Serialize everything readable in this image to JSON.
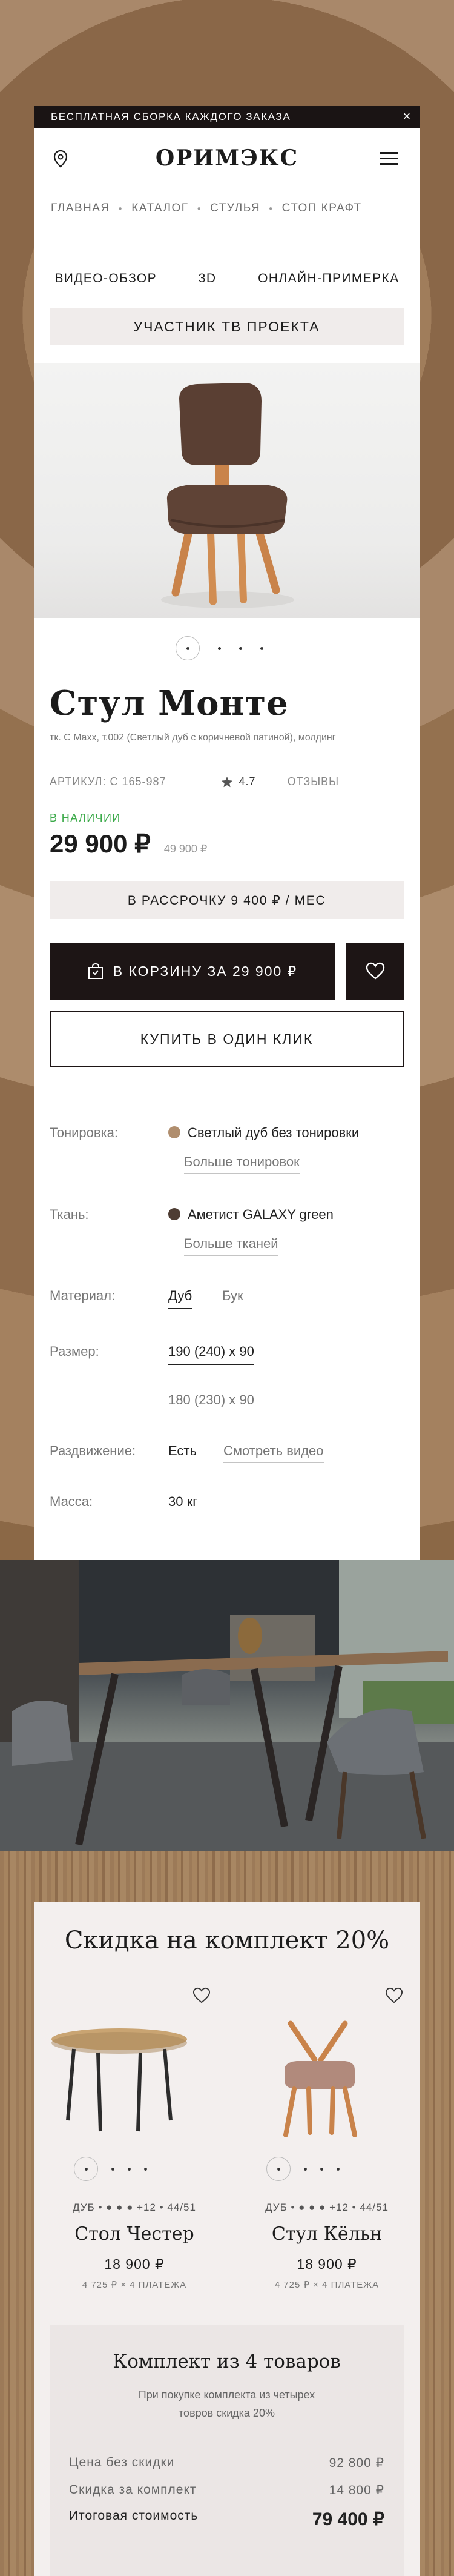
{
  "promo_bar": {
    "text": "БЕСПЛАТНАЯ СБОРКА КАЖДОГО ЗАКАЗА",
    "close": "×"
  },
  "header": {
    "logo": "ОРИМЭКС"
  },
  "breadcrumb": [
    "ГЛАВНАЯ",
    "КАТАЛОГ",
    "СТУЛЬЯ",
    "СТОП КРАФТ"
  ],
  "media_tabs": [
    "ВИДЕО-ОБЗОР",
    "3D",
    "ОНЛАЙН-ПРИМЕРКА"
  ],
  "tv_button": "УЧАСТНИК ТВ ПРОЕКТА",
  "product": {
    "title": "Стул Монте",
    "subtitle": "тк. С Maxx, т.002 (Светлый дуб с коричневой патиной), молдинг",
    "article": "АРТИКУЛ: С 165-987",
    "rating": "4.7",
    "reviews": "ОТЗЫВЫ",
    "stock": "В НАЛИЧИИ",
    "price": "29 900 ₽",
    "old_price": "49 900 ₽",
    "installment": "В РАССРОЧКУ 9 400 ₽ / МЕС",
    "cart_button": "В КОРЗИНУ ЗА 29 900 ₽",
    "one_click": "КУПИТЬ В ОДИН КЛИК"
  },
  "specs": {
    "toning_label": "Тонировка:",
    "toning_value": "Светлый дуб без тонировки",
    "toning_more": "Больше тонировок",
    "fabric_label": "Ткань:",
    "fabric_value": "Аметист GALAXY green",
    "fabric_more": "Больше тканей",
    "material_label": "Материал:",
    "material_options": [
      "Дуб",
      "Бук"
    ],
    "size_label": "Размер:",
    "size_options": [
      "190 (240) х 90",
      "180 (230) х 90"
    ],
    "extend_label": "Раздвижение:",
    "extend_value": "Есть",
    "extend_video": "Смотреть видео",
    "weight_label": "Масса:",
    "weight_value": "30 кг"
  },
  "colors": {
    "toning_swatch": "#b08e6e",
    "fabric_swatch": "#4e3d33",
    "stock": "#3caa4a",
    "dark": "#1d1515"
  },
  "set_offer": {
    "title": "Скидка на комплект 20%",
    "products": [
      {
        "colors": "ДУБ • ● ● ● +12 • 44/51",
        "name": "Стол Честер",
        "price": "18 900 ₽",
        "installment": "4 725 ₽ × 4 ПЛАТЕЖА"
      },
      {
        "colors": "ДУБ • ● ● ● +12 • 44/51",
        "name": "Стул Кёльн",
        "price": "18 900 ₽",
        "installment": "4 725 ₽ × 4 ПЛАТЕЖА"
      }
    ],
    "summary": {
      "title": "Комплект из 4 товаров",
      "description": "При покупке комплекта из четырех товров скидка 20%",
      "rows": [
        {
          "label": "Цена без скидки",
          "value": "92 800 ₽"
        },
        {
          "label": "Скидка за комплект",
          "value": "14 800 ₽"
        },
        {
          "label": "Итоговая стоимость",
          "value": "79 400 ₽"
        }
      ]
    }
  }
}
